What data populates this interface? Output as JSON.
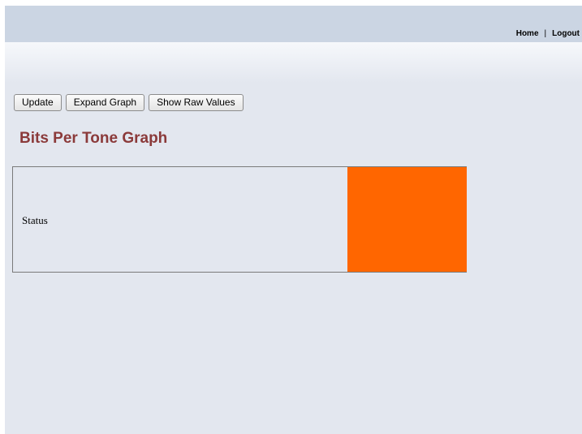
{
  "header": {
    "nav": {
      "home_label": "Home",
      "separator": "|",
      "logout_label": "Logout"
    }
  },
  "toolbar": {
    "update_label": "Update",
    "expand_graph_label": "Expand Graph",
    "show_raw_values_label": "Show Raw Values"
  },
  "main": {
    "title": "Bits Per Tone Graph",
    "status": {
      "label": "Status",
      "indicator_color": "#ff6600"
    }
  },
  "colors": {
    "page_background": "#e3e7ef",
    "header_background": "#cbd5e3",
    "title_color": "#8b3a3a"
  }
}
